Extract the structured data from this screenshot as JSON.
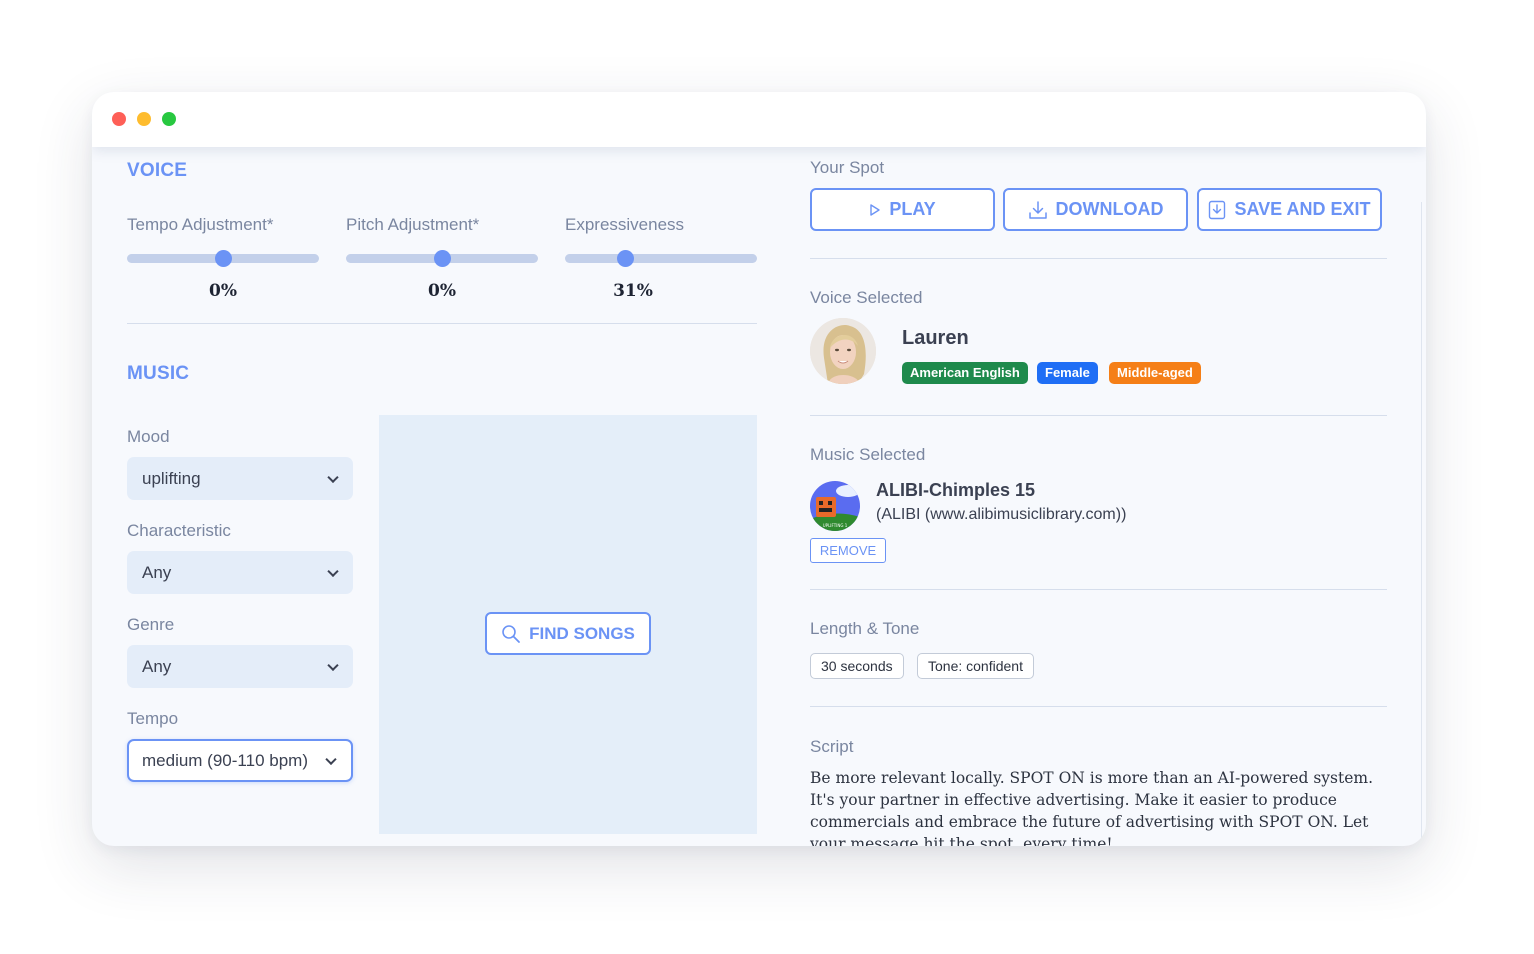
{
  "window": {
    "controls": [
      "close",
      "minimize",
      "maximize"
    ]
  },
  "voice": {
    "title": "VOICE",
    "sliders": [
      {
        "label": "Tempo Adjustment*",
        "value_text": "0%",
        "value": 0,
        "min": -100,
        "max": 100
      },
      {
        "label": "Pitch Adjustment*",
        "value_text": "0%",
        "value": 0,
        "min": -100,
        "max": 100
      },
      {
        "label": "Expressiveness",
        "value_text": "31%",
        "value": 31,
        "min": 0,
        "max": 100
      }
    ]
  },
  "music": {
    "title": "MUSIC",
    "filters": [
      {
        "label": "Mood",
        "value": "uplifting"
      },
      {
        "label": "Characteristic",
        "value": "Any"
      },
      {
        "label": "Genre",
        "value": "Any"
      },
      {
        "label": "Tempo",
        "value": "medium (90-110 bpm)"
      }
    ],
    "find_songs_label": "FIND SONGS",
    "find_songs_icon": "search-icon"
  },
  "spot": {
    "title": "Your Spot",
    "actions": [
      {
        "label": "PLAY",
        "icon": "play-icon"
      },
      {
        "label": "DOWNLOAD",
        "icon": "download-icon"
      },
      {
        "label": "SAVE AND EXIT",
        "icon": "save-exit-icon"
      }
    ],
    "voice_selected": {
      "heading": "Voice Selected",
      "name": "Lauren",
      "badges": [
        {
          "text": "American English",
          "color": "#1e8a4c"
        },
        {
          "text": "Female",
          "color": "#1f6ef5"
        },
        {
          "text": "Middle-aged",
          "color": "#f57f17"
        }
      ]
    },
    "music_selected": {
      "heading": "Music Selected",
      "track": "ALIBI-Chimples 15",
      "source": "(ALIBI (www.alibimusiclibrary.com))",
      "cover_caption": "UPLIFTING 1",
      "remove_label": "REMOVE"
    },
    "length_tone": {
      "heading": "Length & Tone",
      "chips": [
        "30 seconds",
        "Tone: confident"
      ]
    },
    "script": {
      "heading": "Script",
      "text": "Be more relevant locally. SPOT ON is more than an AI-powered system. It's your partner in effective advertising. Make it easier to produce commercials and embrace the future of advertising with SPOT ON. Let your message hit the spot, every time!"
    }
  },
  "colors": {
    "accent": "#6b93f5",
    "slider_track": "#c3d0ea",
    "panel": "#e4eef9"
  }
}
